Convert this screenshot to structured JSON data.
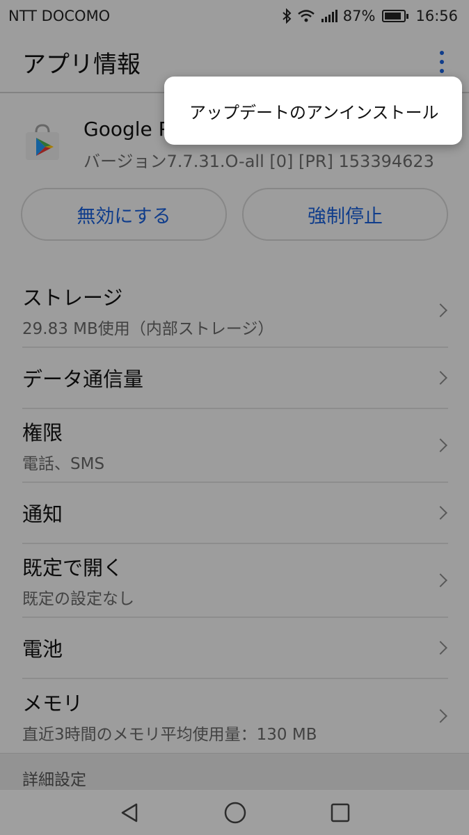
{
  "status_bar": {
    "carrier": "NTT DOCOMO",
    "battery_percent": "87%",
    "battery_level": 0.87,
    "time": "16:56",
    "icons": [
      "bluetooth-icon",
      "wifi-icon",
      "signal-icon",
      "battery-icon"
    ]
  },
  "app_bar": {
    "title": "アプリ情報",
    "overflow_icon": "overflow-menu-icon"
  },
  "app": {
    "name": "Google Play ストア",
    "version": "バージョン7.7.31.O-all [0] [PR] 153394623",
    "icon": "google-play-store-icon"
  },
  "buttons": {
    "disable": "無効にする",
    "force_stop": "強制停止"
  },
  "settings": [
    {
      "title": "ストレージ",
      "subtitle": "29.83 MB使用（内部ストレージ）"
    },
    {
      "title": "データ通信量",
      "subtitle": ""
    },
    {
      "title": "権限",
      "subtitle": "電話、SMS"
    },
    {
      "title": "通知",
      "subtitle": ""
    },
    {
      "title": "既定で開く",
      "subtitle": "既定の設定なし"
    },
    {
      "title": "電池",
      "subtitle": ""
    },
    {
      "title": "メモリ",
      "subtitle": "直近3時間のメモリ平均使用量：130 MB"
    }
  ],
  "section_header": "詳細設定",
  "popup_menu": {
    "items": [
      "アップデートのアンインストール"
    ]
  },
  "nav": {
    "back": "back-icon",
    "home": "home-icon",
    "recents": "recents-icon"
  },
  "colors": {
    "accent": "#1a5fd6",
    "background": "#f2f2f2",
    "popup": "#ffffff"
  }
}
